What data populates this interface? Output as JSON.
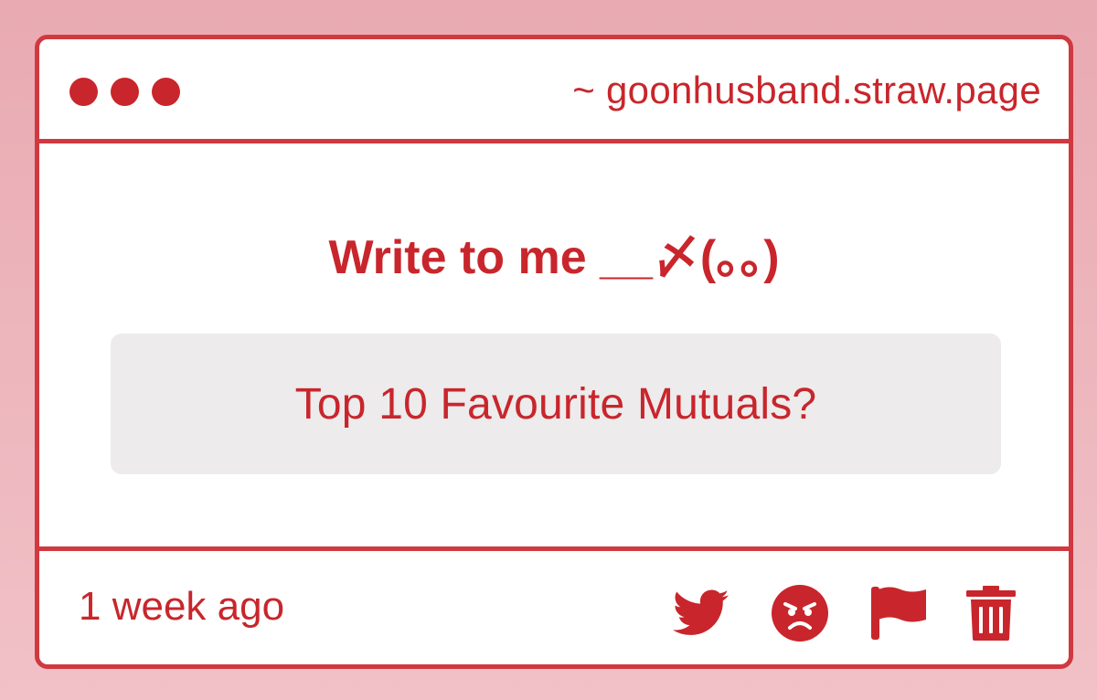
{
  "window": {
    "url": "~ goonhusband.straw.page"
  },
  "main": {
    "heading": "Write to me __〆(。。)",
    "question": "Top 10 Favourite Mutuals?"
  },
  "footer": {
    "timestamp": "1 week ago",
    "actions": [
      {
        "icon": "twitter-icon"
      },
      {
        "icon": "angry-face-icon"
      },
      {
        "icon": "flag-icon"
      },
      {
        "icon": "trash-icon"
      }
    ]
  },
  "colors": {
    "accent": "#c8262c",
    "border": "#d0393f",
    "background": "#eeb4bb",
    "question_bg": "#edebec"
  }
}
